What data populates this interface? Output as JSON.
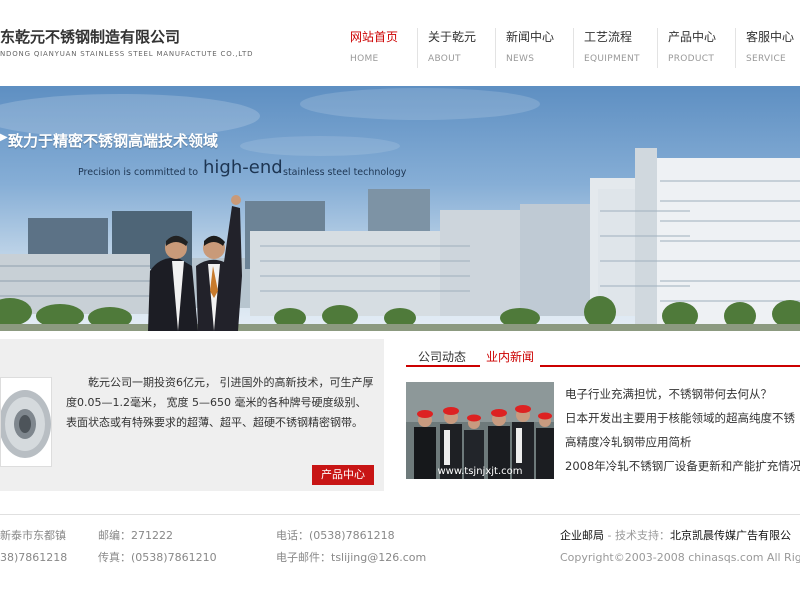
{
  "header": {
    "company_name": "东乾元不锈钢制造有限公司",
    "company_name_en": "NDONG QIANYUAN STAINLESS STEEL MANUFACTUTE CO.,LTD"
  },
  "nav": [
    {
      "cn": "网站首页",
      "en": "HOME",
      "active": true
    },
    {
      "cn": "关于乾元",
      "en": "ABOUT",
      "active": false
    },
    {
      "cn": "新闻中心",
      "en": "NEWS",
      "active": false
    },
    {
      "cn": "工艺流程",
      "en": "EQUIPMENT",
      "active": false
    },
    {
      "cn": "产品中心",
      "en": "PRODUCT",
      "active": false
    },
    {
      "cn": "客服中心",
      "en": "SERVICE",
      "active": false
    }
  ],
  "banner": {
    "slogan": "致力于精密不锈钢高端技术领域",
    "tagline_pre": "Precision is committed to",
    "tagline_highlight": "high-end",
    "tagline_post": "stainless steel technology"
  },
  "intro": {
    "text": "乾元公司一期投资6亿元， 引进国外的高新技术，可生产厚度0.05—1.2毫米， 宽度 5—650 毫米的各种牌号硬度级别、表面状态或有特殊要求的超薄、超平、超硬不锈钢精密钢带。",
    "button": "产品中心"
  },
  "news": {
    "tabs": [
      "公司动态",
      "业内新闻"
    ],
    "active_tab": 1,
    "image_watermark": "www.tsjnjxjt.com",
    "items": [
      "电子行业充满担忧，不锈钢带何去何从？",
      "日本开发出主要用于核能领域的超高纯度不锈",
      "高精度冷轧钢带应用简析",
      "2008年冷轧不锈钢厂设备更新和产能扩充情况"
    ]
  },
  "footer": {
    "address": "新泰市东都镇",
    "phone_partial": "38)7861218",
    "postcode": "邮编：271222",
    "fax": "传真：(0538)7861210",
    "tel": "电话：(0538)7861218",
    "email": "电子邮件：tslijing@126.com",
    "mail_link": "企业邮局",
    "support_label": " - 技术支持：",
    "support_company": "北京凯晨传媒广告有限公",
    "copyright": "Copyright©2003-2008 chinasqs.com All Righ"
  },
  "colors": {
    "accent": "#cc0000",
    "button_bg": "#c81515",
    "intro_bg": "#efefef"
  }
}
